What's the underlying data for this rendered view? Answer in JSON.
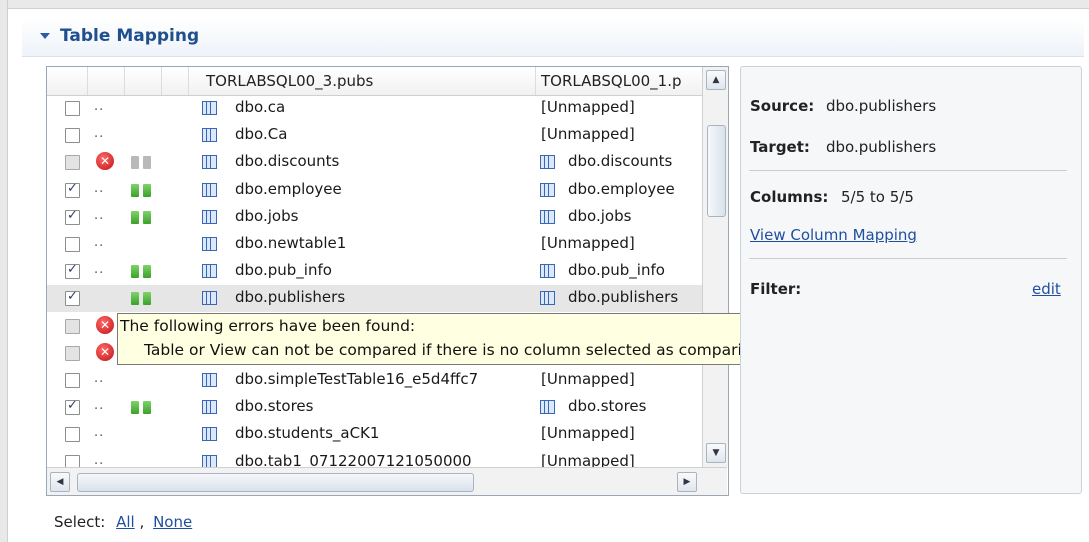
{
  "section": {
    "title": "Table Mapping"
  },
  "table": {
    "columns": [
      "TORLABSQL00_3.pubs",
      "TORLABSQL00_1.p"
    ],
    "rows": [
      {
        "checkbox": "unchecked",
        "status": "dots",
        "bars": "none",
        "source": "dbo.ca",
        "target": "[Unmapped]",
        "target_icon": false
      },
      {
        "checkbox": "unchecked",
        "status": "dots",
        "bars": "none",
        "source": "dbo.Ca",
        "target": "[Unmapped]",
        "target_icon": false
      },
      {
        "checkbox": "disabled",
        "status": "error",
        "bars": "gray",
        "source": "dbo.discounts",
        "target": "dbo.discounts",
        "target_icon": true
      },
      {
        "checkbox": "checked",
        "status": "dots",
        "bars": "green",
        "source": "dbo.employee",
        "target": "dbo.employee",
        "target_icon": true
      },
      {
        "checkbox": "checked",
        "status": "dots",
        "bars": "green",
        "source": "dbo.jobs",
        "target": "dbo.jobs",
        "target_icon": true
      },
      {
        "checkbox": "unchecked",
        "status": "dots",
        "bars": "none",
        "source": "dbo.newtable1",
        "target": "[Unmapped]",
        "target_icon": false
      },
      {
        "checkbox": "checked",
        "status": "dots",
        "bars": "green",
        "source": "dbo.pub_info",
        "target": "dbo.pub_info",
        "target_icon": true
      },
      {
        "checkbox": "checked",
        "status": "none",
        "bars": "green",
        "source": "dbo.publishers",
        "target": "dbo.publishers",
        "target_icon": true,
        "selected": true
      },
      {
        "checkbox": "disabled",
        "status": "error",
        "bars": "none",
        "source": "",
        "target": "",
        "target_icon": false
      },
      {
        "checkbox": "disabled",
        "status": "error",
        "bars": "none",
        "source": "",
        "target": "",
        "target_icon": false
      },
      {
        "checkbox": "unchecked",
        "status": "dots",
        "bars": "none",
        "source": "dbo.simpleTestTable16_e5d4ffc7",
        "target": "[Unmapped]",
        "target_icon": false
      },
      {
        "checkbox": "checked",
        "status": "dots",
        "bars": "green",
        "source": "dbo.stores",
        "target": "dbo.stores",
        "target_icon": true
      },
      {
        "checkbox": "unchecked",
        "status": "dots",
        "bars": "none",
        "source": "dbo.students_aCK1",
        "target": "[Unmapped]",
        "target_icon": false
      },
      {
        "checkbox": "unchecked",
        "status": "dots",
        "bars": "none",
        "source": "dbo.tab1_07122007121050000",
        "target": "[Unmapped]",
        "target_icon": false
      }
    ]
  },
  "tooltip": {
    "line1": "The following errors have been found:",
    "line2": "Table or View can not be compared if there is no column selected as comparison key"
  },
  "details": {
    "source_label": "Source:",
    "source_value": "dbo.publishers",
    "target_label": "Target:",
    "target_value": "dbo.publishers",
    "columns_label": "Columns:",
    "columns_value": "5/5 to 5/5",
    "view_mapping_link": "View Column Mapping",
    "filter_label": "Filter:",
    "filter_edit": "edit"
  },
  "select": {
    "label": "Select:",
    "all": "All",
    "separator": ",",
    "none": "None"
  }
}
